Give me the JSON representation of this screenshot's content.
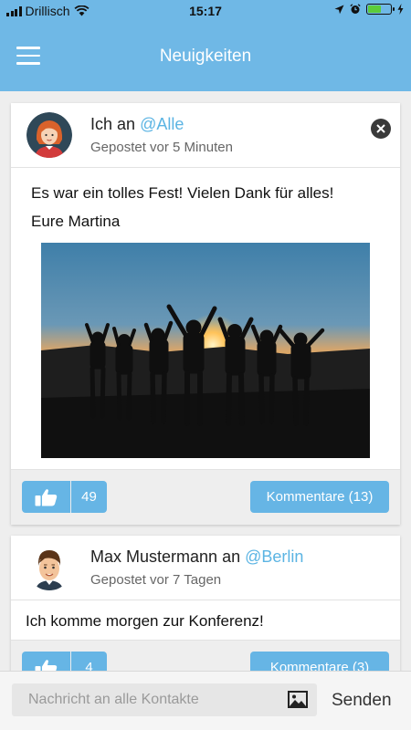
{
  "status_bar": {
    "carrier": "Drillisch",
    "time": "15:17",
    "battery_level": 0.6,
    "icons": [
      "signal-icon",
      "wifi-icon",
      "location-icon",
      "alarm-icon",
      "battery-icon",
      "charging-icon"
    ]
  },
  "header": {
    "title": "Neuigkeiten",
    "menu_icon": "hamburger-menu-icon"
  },
  "posts": [
    {
      "author": "Ich",
      "connector": "an",
      "audience": "@Alle",
      "posted": "Gepostet vor 5 Minuten",
      "lines": [
        "Es war ein tolles Fest! Vielen Dank für alles!",
        "Eure Martina"
      ],
      "likes": "49",
      "comments_label": "Kommentare (13)",
      "avatar": "woman-avatar-icon",
      "has_close": true,
      "has_photo": true
    },
    {
      "author": "Max Mustermann",
      "connector": "an",
      "audience": "@Berlin",
      "posted": "Gepostet vor 7 Tagen",
      "lines": [
        "Ich komme morgen zur Konferenz!"
      ],
      "likes": "4",
      "comments_label": "Kommentare (3)",
      "avatar": "man-avatar-icon",
      "has_close": false,
      "has_photo": false
    }
  ],
  "composer": {
    "placeholder": "Nachricht an alle Kontakte",
    "send_label": "Senden",
    "attach_icon": "image-icon"
  },
  "colors": {
    "header_bg": "#6fb8e6",
    "accent": "#66b5e5",
    "audience_text": "#5bb4e3"
  }
}
